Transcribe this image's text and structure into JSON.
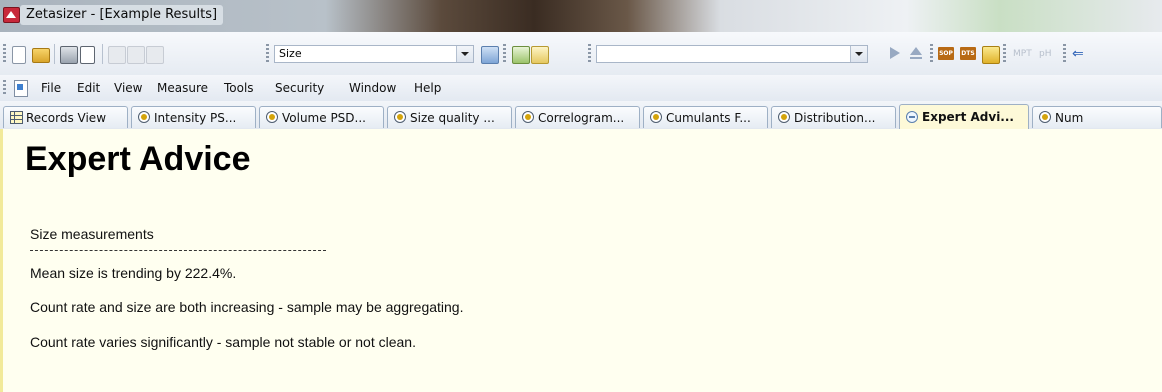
{
  "window": {
    "title": "Zetasizer - [Example Results]"
  },
  "toolbar": {
    "measurement_type": "Size",
    "second_combo_value": "",
    "icons": [
      "new-icon",
      "open-icon",
      "print-icon",
      "print-preview-icon",
      "cut-icon",
      "copy-icon",
      "paste-icon",
      "properties-icon",
      "sop-run-icon",
      "sop-edit-icon",
      "play-icon",
      "eject-icon",
      "sop-icon",
      "dts-icon",
      "export-icon",
      "mpt-icon",
      "mpt-ph-icon",
      "back-arrow-icon"
    ],
    "badge_sop": "SOP",
    "badge_dts": "DTS",
    "faint_mpt": "MPT",
    "faint_ph": "pH"
  },
  "menu": {
    "items": [
      "File",
      "Edit",
      "View",
      "Measure",
      "Tools",
      "Security",
      "Window",
      "Help"
    ]
  },
  "tabs": [
    {
      "label": "Records View",
      "icon": "grid-icon",
      "active": false
    },
    {
      "label": "Intensity PS...",
      "icon": "report-icon",
      "active": false
    },
    {
      "label": "Volume PSD...",
      "icon": "report-icon",
      "active": false
    },
    {
      "label": "Size quality ...",
      "icon": "report-icon",
      "active": false
    },
    {
      "label": "Correlogram...",
      "icon": "report-icon",
      "active": false
    },
    {
      "label": "Cumulants F...",
      "icon": "report-icon",
      "active": false
    },
    {
      "label": "Distribution...",
      "icon": "report-icon",
      "active": false
    },
    {
      "label": "Expert Advi...",
      "icon": "expert-icon",
      "active": true
    },
    {
      "label": "Num",
      "icon": "report-icon",
      "active": false
    }
  ],
  "document": {
    "heading": "Expert Advice",
    "section": "Size measurements",
    "messages": [
      "Mean size is trending by 222.4%.",
      "Count rate and size are both increasing - sample may be aggregating.",
      "Count rate varies significantly - sample not stable or not clean."
    ]
  },
  "colors": {
    "document_background": "#fffff0",
    "active_tab": "#fdf9d8",
    "app_icon": "#c8283a"
  }
}
